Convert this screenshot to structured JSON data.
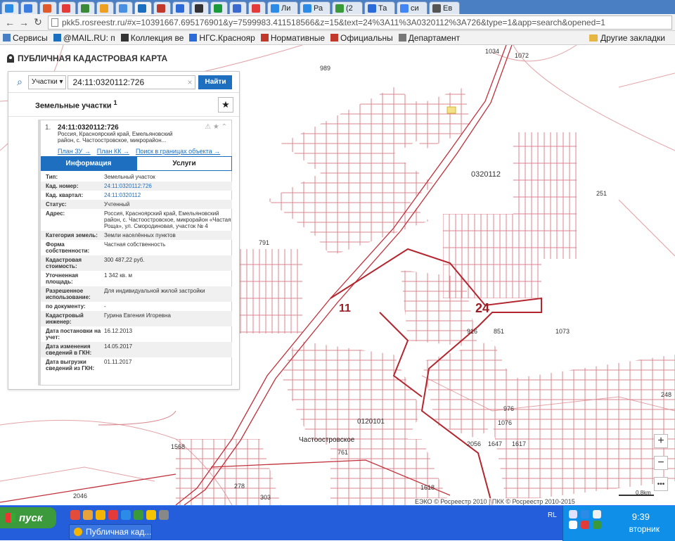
{
  "browser": {
    "tabs": [
      {
        "label": "",
        "color": "#2b8be6"
      },
      {
        "label": "",
        "color": "#3b7de0"
      },
      {
        "label": "",
        "color": "#e05a2a"
      },
      {
        "label": "",
        "color": "#e33a3a"
      },
      {
        "label": "",
        "color": "#3a8a3a"
      },
      {
        "label": "",
        "color": "#f0a020"
      },
      {
        "label": "",
        "color": "#4a90e2"
      },
      {
        "label": "",
        "color": "#1b6fbf",
        "active": true
      },
      {
        "label": "",
        "color": "#c0392b"
      },
      {
        "label": "",
        "color": "#2d6ad9"
      },
      {
        "label": "",
        "color": "#333333"
      },
      {
        "label": "",
        "color": "#1a9a3a"
      },
      {
        "label": "",
        "color": "#3a6ad0"
      },
      {
        "label": "",
        "color": "#e33a3a"
      },
      {
        "label": "Ли",
        "color": "#2b8be6"
      },
      {
        "label": "Ра",
        "color": "#2b8be6"
      },
      {
        "label": "(2",
        "color": "#3a9a3a"
      },
      {
        "label": "Та",
        "color": "#2b6ad9"
      },
      {
        "label": "си",
        "color": "#4285f4"
      },
      {
        "label": "Ев",
        "color": "#555555"
      }
    ],
    "url": "pkk5.rosreestr.ru/#x=10391667.695176901&y=7599983.411518566&z=15&text=24%3A11%3A0320112%3A726&type=1&app=search&opened=1",
    "bookmarks": [
      {
        "label": "Сервисы",
        "color": "#4a7fc4"
      },
      {
        "label": "@MAIL.RU: п",
        "color": "#1b6fbf"
      },
      {
        "label": "Коллекция ве",
        "color": "#333333"
      },
      {
        "label": "НГС.Краснояр",
        "color": "#2b6ad9"
      },
      {
        "label": "Нормативные",
        "color": "#c0392b"
      },
      {
        "label": "Официальны",
        "color": "#c0392b"
      },
      {
        "label": "Департамент",
        "color": "#777777"
      }
    ],
    "other_bookmarks": "Другие закладки"
  },
  "app": {
    "title": "ПУБЛИЧНАЯ КАДАСТРОВАЯ КАРТА",
    "search": {
      "category": "Участки",
      "query": "24:11:0320112:726",
      "button": "Найти"
    },
    "section_title": "Земельные участки",
    "section_count": "1",
    "result": {
      "index": "1.",
      "cadastral_number": "24:11:0320112:726",
      "address_short": "Россия, Красноярский край, Емельяновский район, с. Частоостровское, микрорайон...",
      "links": [
        "План ЗУ →",
        "План КК →",
        "Поиск в границах объекта →"
      ],
      "tabs": [
        "Информация",
        "Услуги"
      ],
      "attributes": [
        {
          "k": "Тип:",
          "v": "Земельный участок"
        },
        {
          "k": "Кад. номер:",
          "v": "24:11:0320112:726",
          "link": true
        },
        {
          "k": "Кад. квартал:",
          "v": "24:11:0320112",
          "link": true
        },
        {
          "k": "Статус:",
          "v": "Учтенный"
        },
        {
          "k": "Адрес:",
          "v": "Россия, Красноярский край, Емельяновский район, с. Частоостровское, микрорайон «Частая Роща», ул. Смородиновая, участок № 4"
        },
        {
          "k": "Категория земель:",
          "v": "Земли населённых пунктов"
        },
        {
          "k": "Форма собственности:",
          "v": "Частная собственность"
        },
        {
          "k": "Кадастровая стоимость:",
          "v": "300 487,22 руб."
        },
        {
          "k": "Уточненная площадь:",
          "v": "1 342 кв. м"
        },
        {
          "k": "Разрешенное использование:",
          "v": "Для индивидуальной жилой застройки"
        },
        {
          "k": "по документу:",
          "v": "-"
        },
        {
          "k": "Кадастровый инженер:",
          "v": "Гурина Евгения Игоревна"
        },
        {
          "k": "Дата постановки на учет:",
          "v": "16.12.2013"
        },
        {
          "k": "Дата изменения сведений в ГКН:",
          "v": "14.05.2017"
        },
        {
          "k": "Дата выгрузки сведений из ГКН:",
          "v": "01.11.2017"
        }
      ]
    },
    "map_labels": [
      {
        "text": "989"
      },
      {
        "text": "1034"
      },
      {
        "text": "1072"
      },
      {
        "text": "0320112"
      },
      {
        "text": "251"
      },
      {
        "text": "1073"
      },
      {
        "text": "248"
      },
      {
        "text": "11"
      },
      {
        "text": "24"
      },
      {
        "text": "0120101"
      },
      {
        "text": "Частоостровское"
      },
      {
        "text": "1568"
      },
      {
        "text": "278"
      },
      {
        "text": "303"
      },
      {
        "text": "1618"
      },
      {
        "text": "1617"
      },
      {
        "text": "1647"
      },
      {
        "text": "2056"
      },
      {
        "text": "976"
      },
      {
        "text": "1076"
      },
      {
        "text": "916"
      },
      {
        "text": "851"
      },
      {
        "text": "791"
      },
      {
        "text": "761"
      },
      {
        "text": "2046"
      }
    ],
    "attribution": "ЕЭКО © Росреестр 2010 | ПКК © Росреестр 2010-2015",
    "scale": "0.8km",
    "zoom_in": "+",
    "zoom_out": "−",
    "more": "•••"
  },
  "taskbar": {
    "start": "пуск",
    "task": "Публичная кад...",
    "lang": "RL",
    "time": "9:39",
    "day": "вторник"
  }
}
